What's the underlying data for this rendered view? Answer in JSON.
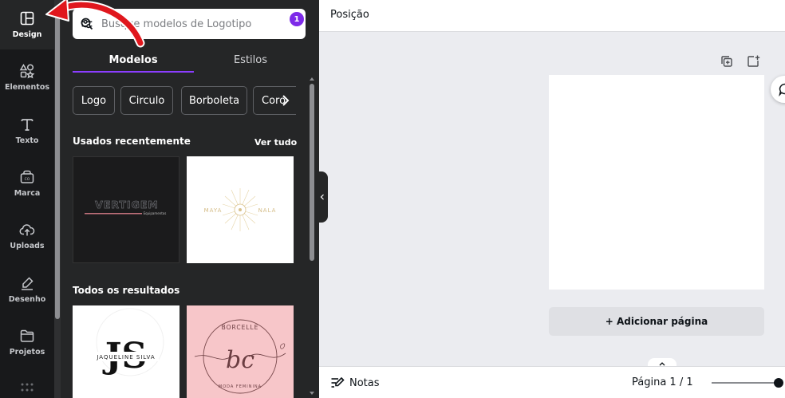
{
  "rail": {
    "items": [
      {
        "label": "Design",
        "icon": "layout-icon"
      },
      {
        "label": "Elementos",
        "icon": "shapes-icon"
      },
      {
        "label": "Texto",
        "icon": "text-icon"
      },
      {
        "label": "Marca",
        "icon": "brand-icon"
      },
      {
        "label": "Uploads",
        "icon": "cloud-upload-icon"
      },
      {
        "label": "Desenho",
        "icon": "pen-icon"
      },
      {
        "label": "Projetos",
        "icon": "folder-icon"
      }
    ]
  },
  "panel": {
    "search": {
      "placeholder": "Busque modelos de Logotipo",
      "filter_badge": "1"
    },
    "tabs": [
      "Modelos",
      "Estilos"
    ],
    "chips": [
      "Logo",
      "Circulo",
      "Borboleta",
      "Coro"
    ],
    "recent": {
      "title": "Usados recentemente",
      "link": "Ver tudo",
      "cards": [
        {
          "logo_text": "VERTIGEM",
          "sub_text": "Equipamentos"
        },
        {
          "logo_text_left": "MAYA",
          "logo_text_right": "NALA"
        }
      ]
    },
    "results": {
      "title": "Todos os resultados",
      "cards": [
        {
          "monogram": "JS",
          "name": "JAQUELINE SILVA"
        },
        {
          "top_text": "BORCELLE",
          "monogram": "bc",
          "bottom_text": "MODA FEMININA"
        }
      ]
    }
  },
  "canvas": {
    "title": "Posição",
    "add_page": "+ Adicionar página"
  },
  "footer": {
    "notes": "Notas",
    "page_info": "Página 1 / 1"
  },
  "colors": {
    "accent": "#8b3dff",
    "badge": "#7d2ae8",
    "annotation_arrow": "#e0171d"
  }
}
